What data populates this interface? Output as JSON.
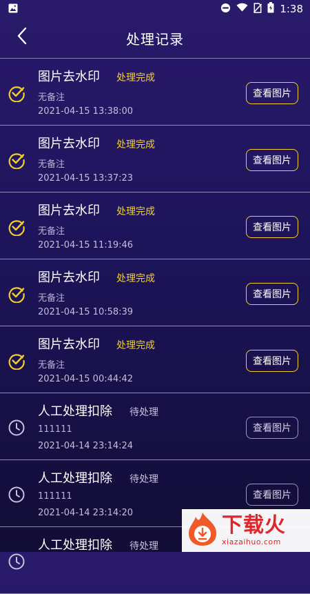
{
  "statusbar": {
    "time": "1:38"
  },
  "header": {
    "title": "处理记录"
  },
  "records": [
    {
      "state": "done",
      "name": "图片去水印",
      "status": "处理完成",
      "note": "无备注",
      "time": "2021-04-15 13:38:00",
      "button": "查看图片"
    },
    {
      "state": "done",
      "name": "图片去水印",
      "status": "处理完成",
      "note": "无备注",
      "time": "2021-04-15 13:37:23",
      "button": "查看图片"
    },
    {
      "state": "done",
      "name": "图片去水印",
      "status": "处理完成",
      "note": "无备注",
      "time": "2021-04-15 11:19:46",
      "button": "查看图片"
    },
    {
      "state": "done",
      "name": "图片去水印",
      "status": "处理完成",
      "note": "无备注",
      "time": "2021-04-15 10:58:39",
      "button": "查看图片"
    },
    {
      "state": "done",
      "name": "图片去水印",
      "status": "处理完成",
      "note": "无备注",
      "time": "2021-04-15 00:44:42",
      "button": "查看图片"
    },
    {
      "state": "pending",
      "name": "人工处理扣除",
      "status": "待处理",
      "note": "111111",
      "time": "2021-04-14 23:14:24",
      "button": "查看图片"
    },
    {
      "state": "pending",
      "name": "人工处理扣除",
      "status": "待处理",
      "note": "111111",
      "time": "2021-04-14 23:14:20",
      "button": "查看图片"
    },
    {
      "state": "pending",
      "name": "人工处理扣除",
      "status": "待处理",
      "note": "",
      "time": "",
      "button": ""
    }
  ],
  "watermark": {
    "cn": "下载火",
    "en": "xiazaihuo.com"
  },
  "colors": {
    "accent": "#f3cf2c",
    "pending": "#c6c2de",
    "bg_top": "#2a1a6b",
    "bg_bottom": "#120d36"
  }
}
